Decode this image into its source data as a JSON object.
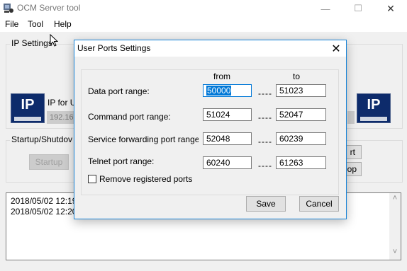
{
  "app": {
    "title": "OCM Server tool",
    "menu": [
      "File",
      "Tool",
      "Help"
    ]
  },
  "main": {
    "ip_settings_label": "IP Settings",
    "ip_for_label": "IP for U",
    "ip_field_value": "192.16",
    "ip_badge_text": "IP",
    "startup_group_label": "Startup/Shutdov",
    "startup_button": "Startup",
    "right_button_1": "rt",
    "right_button_2": "op",
    "log_lines": [
      "2018/05/02 12:19",
      "2018/05/02 12:20"
    ]
  },
  "dialog": {
    "title": "User Ports Settings",
    "col_from": "from",
    "col_to": "to",
    "separator": "----",
    "rows": [
      {
        "label": "Data port range:",
        "from": "50000",
        "to": "51023"
      },
      {
        "label": "Command port range:",
        "from": "51024",
        "to": "52047"
      },
      {
        "label": "Service forwarding port range",
        "from": "52048",
        "to": "60239"
      },
      {
        "label": "Telnet port range:",
        "from": "60240",
        "to": "61263"
      }
    ],
    "checkbox_label": "Remove registered ports",
    "checkbox_checked": false,
    "save_button": "Save",
    "cancel_button": "Cancel"
  },
  "icons": {
    "window_minimize": "—",
    "window_maximize": "☐",
    "window_close": "✕",
    "dialog_close": "✕",
    "scroll_up": "˄",
    "scroll_down": "˅"
  },
  "colors": {
    "accent": "#0078d7",
    "dialog_border": "#1883d7",
    "ip_badge": "#0d2b6b"
  }
}
